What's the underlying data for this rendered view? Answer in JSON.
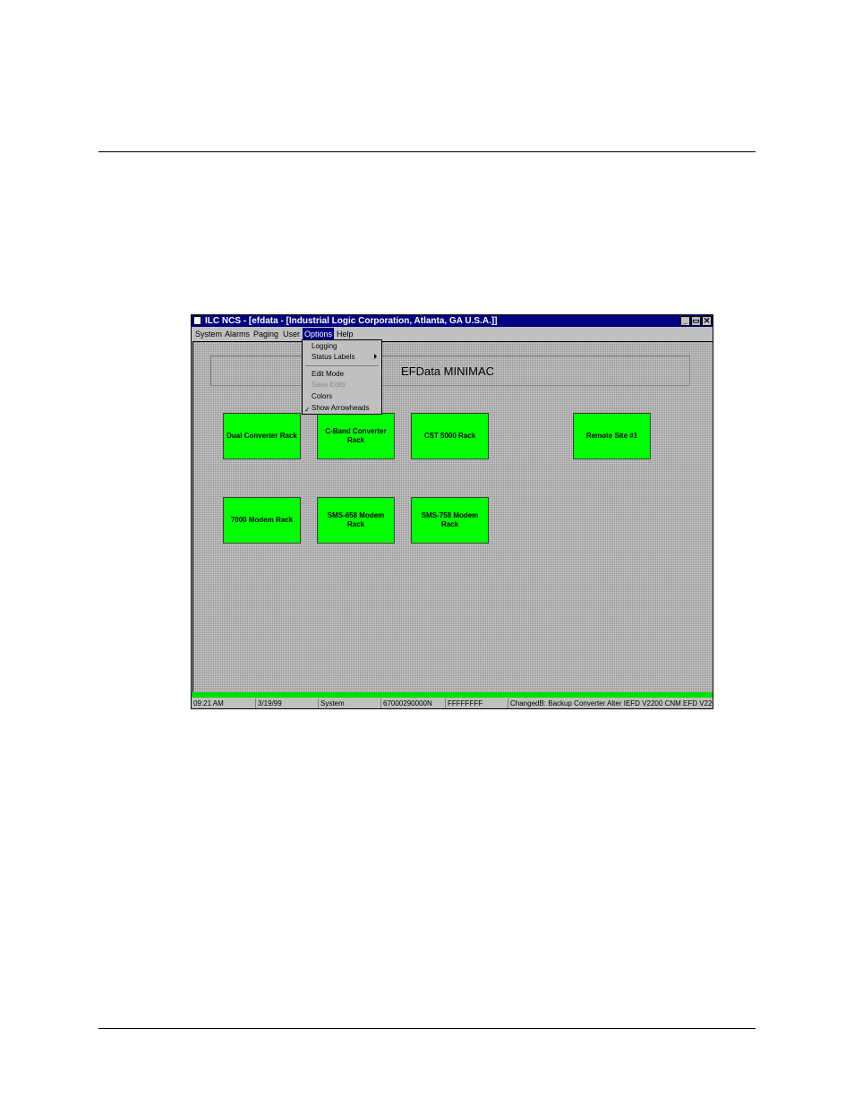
{
  "window": {
    "title": "ILC NCS - [efdata - [Industrial Logic Corporation, Atlanta, GA U.S.A.]]",
    "controls": {
      "minimize": "_",
      "restore": "▭",
      "close": "✕"
    }
  },
  "menu": {
    "items": [
      "System",
      "Alarms",
      "Paging",
      "User",
      "Options",
      "Help"
    ],
    "active": "Options"
  },
  "options_menu": {
    "items": [
      {
        "label": "Logging",
        "enabled": true
      },
      {
        "label": "Status Labels",
        "enabled": true,
        "submenu": true
      },
      {
        "label": "Edit Mode",
        "enabled": true
      },
      {
        "label": "Save Edits",
        "enabled": false
      },
      {
        "label": "Colors",
        "enabled": true
      },
      {
        "label": "Show Arrowheads",
        "enabled": true,
        "checked": true
      }
    ],
    "check_mark": "✓"
  },
  "banner": {
    "title": "EFData MINIMAC"
  },
  "racks": [
    "Dual Converter Rack",
    "C-Band Converter Rack",
    "CST 5000 Rack",
    "Remote Site #1",
    "7000 Modem Rack",
    "SMS-658 Modem Rack",
    "SMS-758 Modem Rack"
  ],
  "status_bar": {
    "time": "09:21 AM",
    "date": "3/19/99",
    "user": "System",
    "code": "67000290000N",
    "hex": "FFFFFFFF",
    "message": "ChangedB: Backup Converter Alter IEFD V2200 CNM EFD V220"
  },
  "colors": {
    "rack_ok": "#00ff00",
    "title_bar": "#000080",
    "status_strip": "#00e000"
  }
}
